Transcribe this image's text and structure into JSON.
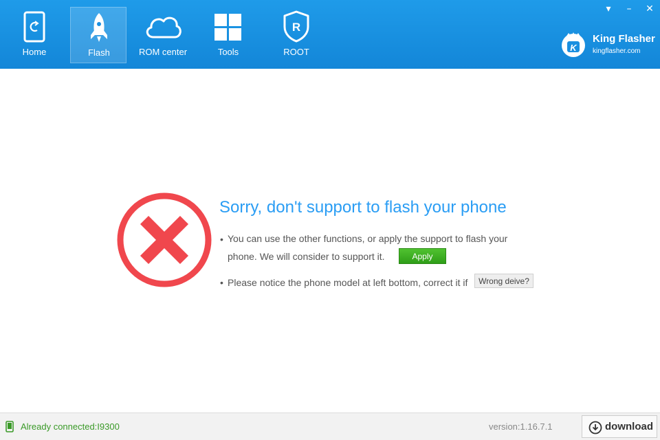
{
  "nav": {
    "items": [
      {
        "label": "Home",
        "icon": "phone-refresh-icon"
      },
      {
        "label": "Flash",
        "icon": "rocket-icon",
        "active": true
      },
      {
        "label": "ROM center",
        "icon": "cloud-icon"
      },
      {
        "label": "Tools",
        "icon": "grid-icon"
      },
      {
        "label": "ROOT",
        "icon": "root-shield-icon"
      }
    ]
  },
  "window": {
    "buttons": [
      {
        "label": "▾",
        "icon": "dropdown-icon"
      },
      {
        "label": "–",
        "icon": "minimize-icon"
      },
      {
        "label": "✕",
        "icon": "close-icon"
      }
    ]
  },
  "brand": {
    "name": "King Flasher",
    "site": "kingflasher.com",
    "logo_letter": "K"
  },
  "message": {
    "title": "Sorry, don't support to flash your phone",
    "bullet1_line1": "You can use the other functions, or apply the support to flash your",
    "bullet1_line2": "phone. We will  consider to support it.",
    "apply_label": "Apply",
    "bullet2": "Please notice the phone model at left bottom, correct it if",
    "wrong_device_label": "Wrong deive?",
    "bullet_char": "•"
  },
  "status": {
    "connection": "Already connected:I9300",
    "version": "version:1.16.7.1",
    "download_label": "download"
  },
  "colors": {
    "topbar": "#1a8fe0",
    "accent_text": "#2a9df4",
    "error_red": "#f0474d",
    "success_green": "#3a9a28",
    "apply_green": "#3fae22"
  }
}
